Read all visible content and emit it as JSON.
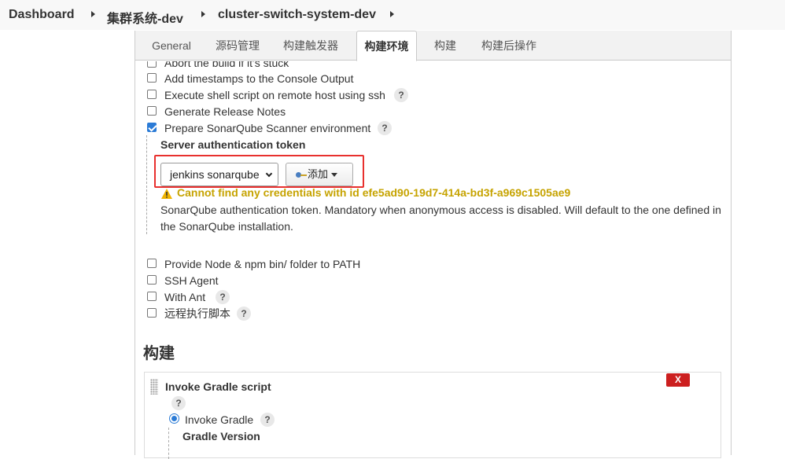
{
  "breadcrumb": {
    "items": [
      "Dashboard",
      "集群系统-dev",
      "cluster-switch-system-dev"
    ]
  },
  "tabs": [
    "General",
    "源码管理",
    "构建触发器",
    "构建环境",
    "构建",
    "构建后操作"
  ],
  "active_tab": "构建环境",
  "build_env_options": [
    {
      "label": "Abort the build if it's stuck",
      "checked": false
    },
    {
      "label": "Add timestamps to the Console Output",
      "checked": false
    },
    {
      "label": "Execute shell script on remote host using ssh",
      "checked": false,
      "help": "?"
    },
    {
      "label": "Generate Release Notes",
      "checked": false
    },
    {
      "label": "Prepare SonarQube Scanner environment",
      "checked": true,
      "help": "?"
    }
  ],
  "sonar": {
    "token_label": "Server authentication token",
    "selected_credential": "jenkins sonarqube",
    "add_button_label": "添加",
    "warning": "Cannot find any credentials with id efe5ad90-19d7-414a-bd3f-a969c1505ae9",
    "description": "SonarQube authentication token. Mandatory when anonymous access is disabled. Will default to the one defined in the SonarQube installation."
  },
  "build_env_options_more": [
    {
      "label": "Provide Node & npm bin/ folder to PATH",
      "checked": false
    },
    {
      "label": "SSH Agent",
      "checked": false
    },
    {
      "label": "With Ant",
      "checked": false,
      "help": "?"
    },
    {
      "label": "远程执行脚本",
      "checked": false,
      "help": "?"
    }
  ],
  "build_section": {
    "title": "构建",
    "step_title": "Invoke Gradle script",
    "step_help": "?",
    "delete_label": "X",
    "radio_label": "Invoke Gradle",
    "radio_help": "?",
    "gradle_version_label": "Gradle Version"
  },
  "colors": {
    "accent": "#2b7bd6",
    "warning": "#c6a300",
    "highlight": "#e8302e",
    "delete": "#cc1f1f"
  }
}
